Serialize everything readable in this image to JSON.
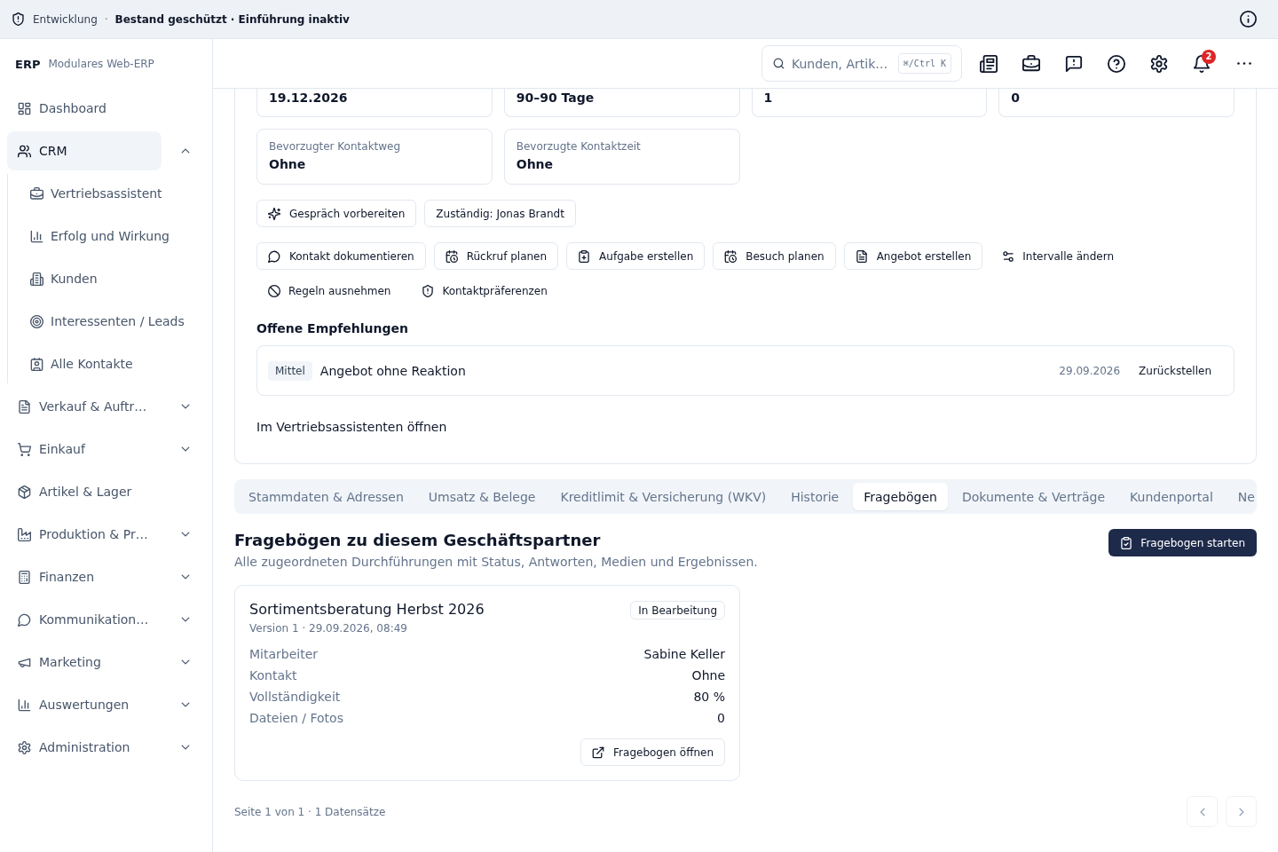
{
  "banner": {
    "environment": "Entwicklung",
    "separator": "·",
    "status": "Bestand geschützt · Einführung inaktiv"
  },
  "sidebar": {
    "brand": "ERP",
    "subtitle": "Modulares Web-ERP",
    "items": [
      {
        "label": "Dashboard",
        "kind": "link",
        "selected": false
      },
      {
        "label": "CRM",
        "kind": "group",
        "selected": true,
        "expanded": true,
        "children": [
          {
            "label": "Vertriebsassistent",
            "selected": false
          },
          {
            "label": "Erfolg und Wirkung",
            "selected": false
          },
          {
            "label": "Kunden",
            "selected": false
          },
          {
            "label": "Interessenten / Leads",
            "selected": false
          },
          {
            "label": "Alle Kontakte",
            "selected": false
          }
        ]
      },
      {
        "label": "Verkauf & Auftr…",
        "kind": "group",
        "selected": false,
        "expanded": false
      },
      {
        "label": "Einkauf",
        "kind": "group",
        "selected": false,
        "expanded": false
      },
      {
        "label": "Artikel & Lager",
        "kind": "link",
        "selected": false
      },
      {
        "label": "Produktion & Pr…",
        "kind": "group",
        "selected": false,
        "expanded": false
      },
      {
        "label": "Finanzen",
        "kind": "group",
        "selected": false,
        "expanded": false
      },
      {
        "label": "Kommunikation…",
        "kind": "group",
        "selected": false,
        "expanded": false
      },
      {
        "label": "Marketing",
        "kind": "group",
        "selected": false,
        "expanded": false
      },
      {
        "label": "Auswertungen",
        "kind": "group",
        "selected": false,
        "expanded": false
      },
      {
        "label": "Administration",
        "kind": "group",
        "selected": false,
        "expanded": false
      }
    ]
  },
  "header": {
    "search": {
      "placeholder": "Kunden, Artik…",
      "shortcut": "⌘/Ctrl K"
    },
    "notification_count": "2"
  },
  "customer_panel": {
    "facts": [
      {
        "value": "19.12.2026"
      },
      {
        "value": "90–90 Tage"
      },
      {
        "value": "1"
      },
      {
        "value": "0"
      },
      {
        "label": "Bevorzugter Kontaktweg",
        "value": "Ohne"
      },
      {
        "label": "Bevorzugte Kontaktzeit",
        "value": "Ohne"
      }
    ],
    "action_rows": [
      {
        "buttons": [
          {
            "label": "Gespräch vorbereiten",
            "kind": "outline"
          },
          {
            "label": "Zuständig: Jonas Brandt",
            "kind": "outline"
          }
        ]
      },
      {
        "buttons": [
          {
            "label": "Kontakt dokumentieren",
            "kind": "outline"
          },
          {
            "label": "Rückruf planen",
            "kind": "outline"
          },
          {
            "label": "Aufgabe erstellen",
            "kind": "outline"
          },
          {
            "label": "Besuch planen",
            "kind": "outline"
          },
          {
            "label": "Angebot erstellen",
            "kind": "outline"
          },
          {
            "label": "Intervalle ändern",
            "kind": "ghost"
          }
        ]
      },
      {
        "buttons": [
          {
            "label": "Regeln ausnehmen",
            "kind": "ghost"
          },
          {
            "label": "Kontaktpräferenzen",
            "kind": "ghost"
          }
        ]
      }
    ],
    "recommendations": {
      "title": "Offene Empfehlungen",
      "items": [
        {
          "priority": "Mittel",
          "title": "Angebot ohne Reaktion",
          "date": "29.09.2026",
          "action": "Zurückstellen"
        }
      ]
    },
    "assistant_link": "Im Vertriebsassistenten öffnen"
  },
  "tabs": [
    {
      "label": "Stammdaten & Adressen",
      "selected": false
    },
    {
      "label": "Umsatz & Belege",
      "selected": false
    },
    {
      "label": "Kreditlimit & Versicherung (WKV)",
      "selected": false
    },
    {
      "label": "Historie",
      "selected": false
    },
    {
      "label": "Fragebögen",
      "selected": true
    },
    {
      "label": "Dokumente & Verträge",
      "selected": false
    },
    {
      "label": "Kundenportal",
      "selected": false
    },
    {
      "label": "Ne",
      "selected": false
    }
  ],
  "questionnaires": {
    "title": "Fragebögen zu diesem Geschäftspartner",
    "subtitle": "Alle zugeordneten Durchführungen mit Status, Antworten, Medien und Ergebnissen.",
    "start_button": "Fragebogen starten",
    "cards": [
      {
        "title": "Sortimentsberatung Herbst 2026",
        "status": "In Bearbeitung",
        "meta": "Version 1 · 29.09.2026, 08:49",
        "fields": [
          {
            "label": "Mitarbeiter",
            "value": "Sabine Keller"
          },
          {
            "label": "Kontakt",
            "value": "Ohne"
          },
          {
            "label": "Vollständigkeit",
            "value": "80 %"
          },
          {
            "label": "Dateien / Fotos",
            "value": "0"
          }
        ],
        "open_button": "Fragebogen öffnen"
      }
    ]
  },
  "pagination": {
    "summary": "Seite 1 von 1 · 1 Datensätze",
    "buttons": [
      {
        "kind": "previous",
        "disabled": true
      },
      {
        "kind": "next",
        "disabled": true
      }
    ]
  }
}
